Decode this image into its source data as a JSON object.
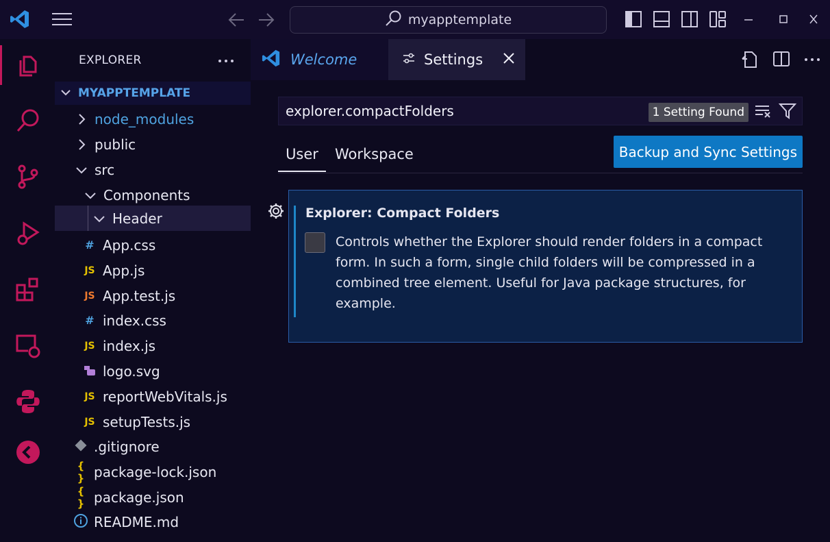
{
  "titlebar": {
    "search_text": "myapptemplate"
  },
  "sidebar": {
    "header": "EXPLORER",
    "root": "MYAPPTEMPLATE",
    "items": [
      {
        "label": "node_modules",
        "icon": "chevron-right-icon",
        "depth": 1,
        "color": "#4fa3e0"
      },
      {
        "label": "public",
        "icon": "chevron-right-icon",
        "depth": 1
      },
      {
        "label": "src",
        "icon": "chevron-down-icon",
        "depth": 1
      },
      {
        "label": "Components",
        "icon": "chevron-down-icon",
        "depth": 2
      },
      {
        "label": "Header",
        "icon": "chevron-down-icon",
        "depth": 3,
        "selected": true
      },
      {
        "label": "App.css",
        "badge": "#",
        "badge_color": "#4fa3e0",
        "depth": 2
      },
      {
        "label": "App.js",
        "badge": "JS",
        "badge_color": "#e5c100",
        "depth": 2
      },
      {
        "label": "App.test.js",
        "badge": "JS",
        "badge_color": "#f07a2e",
        "depth": 2
      },
      {
        "label": "index.css",
        "badge": "#",
        "badge_color": "#4fa3e0",
        "depth": 2
      },
      {
        "label": "index.js",
        "badge": "JS",
        "badge_color": "#e5c100",
        "depth": 2
      },
      {
        "label": "logo.svg",
        "badge": "svg-file-icon",
        "badge_color": "#b27fd8",
        "depth": 2
      },
      {
        "label": "reportWebVitals.js",
        "badge": "JS",
        "badge_color": "#e5c100",
        "depth": 2
      },
      {
        "label": "setupTests.js",
        "badge": "JS",
        "badge_color": "#e5c100",
        "depth": 2
      },
      {
        "label": ".gitignore",
        "badge": "git-icon",
        "badge_color": "#8a8f99",
        "depth": 1
      },
      {
        "label": "package-lock.json",
        "badge": "{ }",
        "badge_color": "#e5c100",
        "depth": 1
      },
      {
        "label": "package.json",
        "badge": "{ }",
        "badge_color": "#e5c100",
        "depth": 1
      },
      {
        "label": "README.md",
        "badge": "info-icon",
        "badge_color": "#4fa3e0",
        "depth": 1
      }
    ]
  },
  "tabs": {
    "welcome": "Welcome",
    "settings": "Settings"
  },
  "settings": {
    "search_value": "explorer.compactFolders",
    "found": "1 Setting Found",
    "scope_user": "User",
    "scope_workspace": "Workspace",
    "sync_button": "Backup and Sync Settings",
    "item_title": "Explorer: Compact Folders",
    "item_description": "Controls whether the Explorer should render folders in a compact form. In such a form, single child folders will be compressed in a combined tree element. Useful for Java package structures, for example.",
    "item_checked": false
  },
  "colors": {
    "accent": "#0e78c4",
    "activity_icons": "#c2185b",
    "active_indicator": "#c2185b"
  }
}
